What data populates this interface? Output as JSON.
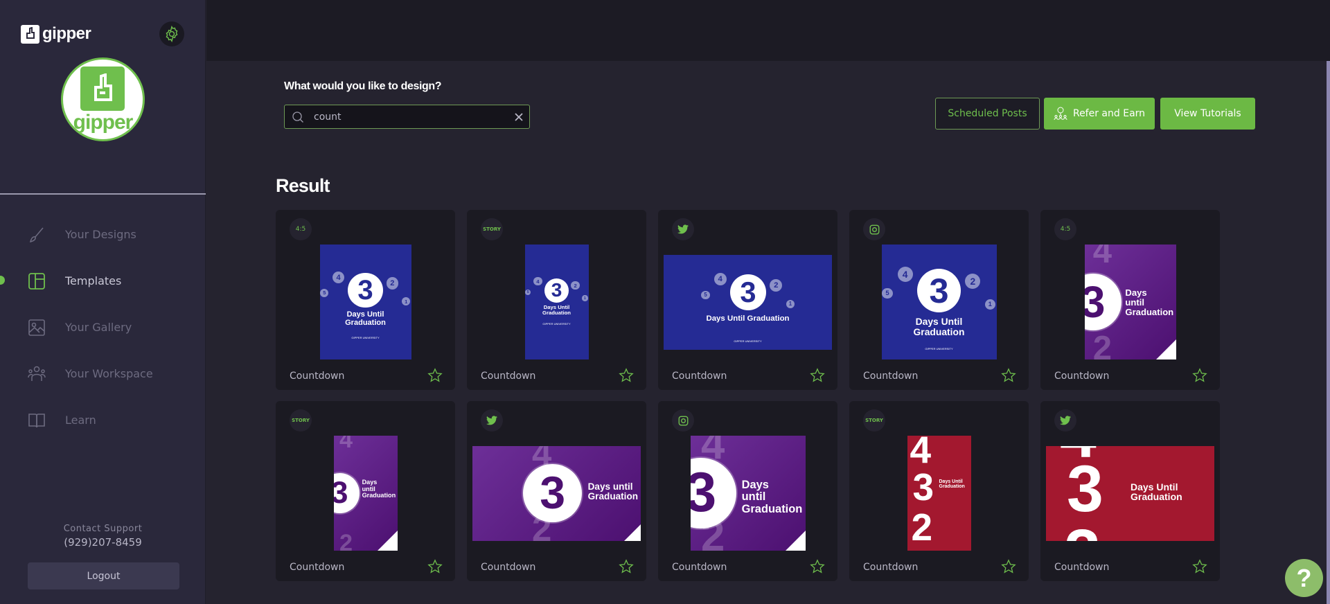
{
  "brand": {
    "name": "gipper",
    "avatar_word": "gipper"
  },
  "sidebar": {
    "items": [
      {
        "label": "Your Designs",
        "icon": "brush-icon",
        "active": false
      },
      {
        "label": "Templates",
        "icon": "layout-icon",
        "active": true
      },
      {
        "label": "Your Gallery",
        "icon": "image-icon",
        "active": false
      },
      {
        "label": "Your Workspace",
        "icon": "users-icon",
        "active": false
      },
      {
        "label": "Learn",
        "icon": "book-icon",
        "active": false
      }
    ],
    "support_label": "Contact Support",
    "support_phone": "(929)207-8459",
    "logout_label": "Logout"
  },
  "main": {
    "prompt": "What would you like to design?",
    "search_value": "count",
    "buttons": {
      "scheduled": "Scheduled Posts",
      "refer": "Refer and Earn",
      "tutorials": "View Tutorials"
    },
    "result_title": "Result",
    "cards": [
      {
        "name": "Countdown",
        "badge": "4:5",
        "badge_type": "text",
        "theme": "blue",
        "format": "portrait"
      },
      {
        "name": "Countdown",
        "badge": "STORY",
        "badge_type": "story",
        "theme": "blue",
        "format": "story"
      },
      {
        "name": "Countdown",
        "badge": "twitter",
        "badge_type": "twitter-icon",
        "theme": "blue",
        "format": "landscape"
      },
      {
        "name": "Countdown",
        "badge": "instagram",
        "badge_type": "instagram-icon",
        "theme": "blue",
        "format": "square"
      },
      {
        "name": "Countdown",
        "badge": "4:5",
        "badge_type": "text",
        "theme": "purple",
        "format": "portrait"
      },
      {
        "name": "Countdown",
        "badge": "STORY",
        "badge_type": "story",
        "theme": "purple",
        "format": "story"
      },
      {
        "name": "Countdown",
        "badge": "twitter",
        "badge_type": "twitter-icon",
        "theme": "purple",
        "format": "landscape"
      },
      {
        "name": "Countdown",
        "badge": "instagram",
        "badge_type": "instagram-icon",
        "theme": "purple",
        "format": "square"
      },
      {
        "name": "Countdown",
        "badge": "STORY",
        "badge_type": "story",
        "theme": "red",
        "format": "story"
      },
      {
        "name": "Countdown",
        "badge": "twitter",
        "badge_type": "twitter-icon",
        "theme": "red",
        "format": "landscape"
      }
    ],
    "thumb_text": {
      "big_number": "3",
      "headline_blue": "Days Until Graduation",
      "headline_purple": "Days until Graduation",
      "sub_blue": "GIPPER UNIVERSITY",
      "sub_purple": "Gipper University",
      "prev_number": "4",
      "next_number": "2",
      "far_prev": "5",
      "far_next": "1"
    }
  },
  "help_label": "?",
  "colors": {
    "accent": "#6fbf4d",
    "sidebar_bg": "#2a283b",
    "main_bg": "#25232f",
    "card_bg": "#1b1a22"
  }
}
